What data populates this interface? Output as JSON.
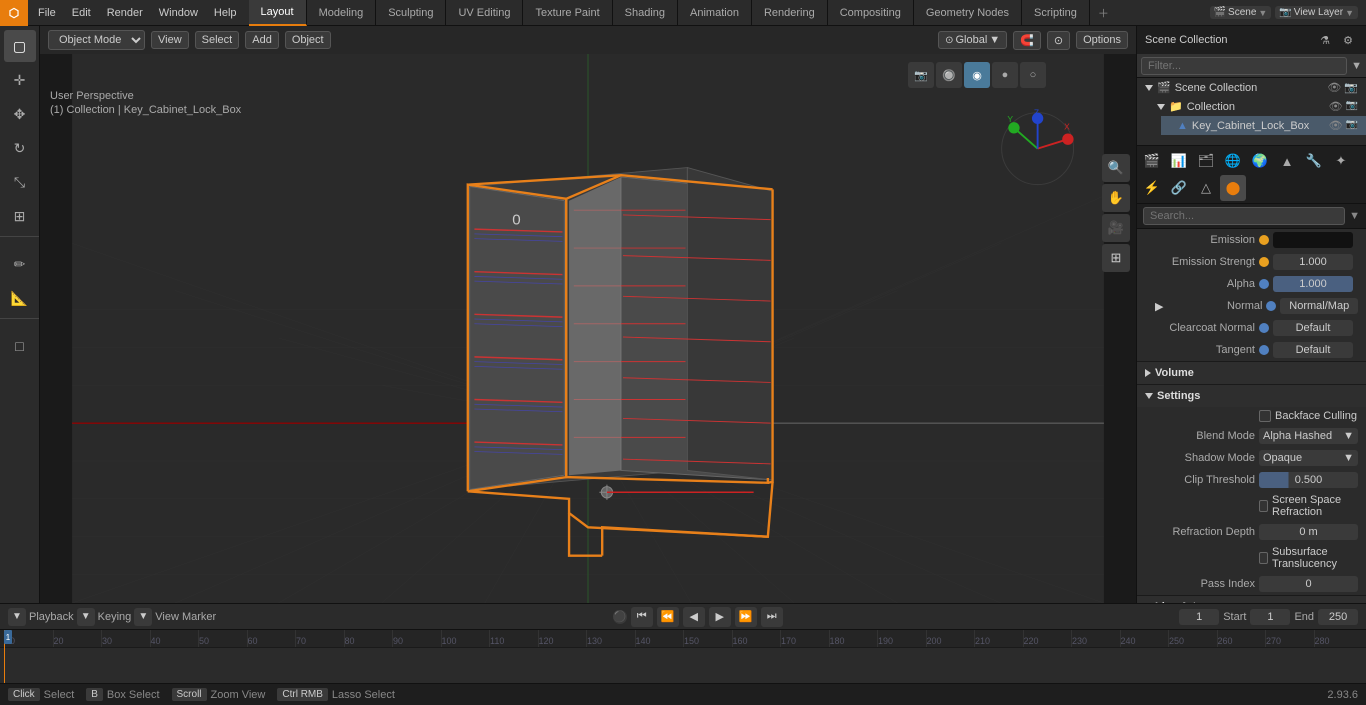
{
  "app": {
    "title": "Blender",
    "version": "2.93.6"
  },
  "menu": {
    "items": [
      "File",
      "Edit",
      "Render",
      "Window",
      "Help"
    ]
  },
  "workspace_tabs": {
    "tabs": [
      "Layout",
      "Modeling",
      "Sculpting",
      "UV Editing",
      "Texture Paint",
      "Shading",
      "Animation",
      "Rendering",
      "Compositing",
      "Geometry Nodes",
      "Scripting"
    ],
    "active": "Layout"
  },
  "viewport": {
    "mode_label": "Object Mode",
    "view_label": "View",
    "select_label": "Select",
    "add_label": "Add",
    "object_label": "Object",
    "transform_label": "Global",
    "camera_label": "User Perspective",
    "collection_label": "(1) Collection | Key_Cabinet_Lock_Box",
    "options_label": "Options"
  },
  "outliner": {
    "title": "Scene Collection",
    "search_placeholder": "Filter...",
    "items": [
      {
        "label": "Scene Collection",
        "level": 0,
        "icon": "scene"
      },
      {
        "label": "Collection",
        "level": 1,
        "icon": "collection"
      },
      {
        "label": "Key_Cabinet_Lock_Box",
        "level": 2,
        "icon": "object",
        "selected": true
      }
    ]
  },
  "properties": {
    "search_placeholder": "Search...",
    "sections": {
      "emission": {
        "label": "Emission",
        "color_value": "#000000",
        "strength_label": "Emission Strengt",
        "strength_value": "1.000",
        "alpha_label": "Alpha",
        "alpha_value": "1.000",
        "normal_label": "Normal",
        "normal_value": "Normal/Map",
        "clearcoat_label": "Clearcoat Normal",
        "clearcoat_value": "Default",
        "tangent_label": "Tangent",
        "tangent_value": "Default"
      },
      "volume": {
        "label": "Volume",
        "collapsed": true
      },
      "settings": {
        "label": "Settings",
        "backface_culling_label": "Backface Culling",
        "backface_culling_checked": false,
        "blend_mode_label": "Blend Mode",
        "blend_mode_value": "Alpha Hashed",
        "shadow_mode_label": "Shadow Mode",
        "shadow_mode_value": "Opaque",
        "clip_threshold_label": "Clip Threshold",
        "clip_threshold_value": "0.500",
        "clip_threshold_percent": 30,
        "screen_space_label": "Screen Space Refraction",
        "screen_space_checked": false,
        "refraction_depth_label": "Refraction Depth",
        "refraction_depth_value": "0 m",
        "subsurface_label": "Subsurface Translucency",
        "subsurface_checked": false,
        "pass_index_label": "Pass Index",
        "pass_index_value": "0"
      }
    }
  },
  "timeline": {
    "current_frame": "1",
    "start_label": "Start",
    "start_value": "1",
    "end_label": "End",
    "end_value": "250",
    "ruler_marks": [
      "10",
      "20",
      "30",
      "40",
      "50",
      "60",
      "70",
      "80",
      "90",
      "100",
      "110",
      "120",
      "130",
      "140",
      "150",
      "160",
      "170",
      "180",
      "190",
      "200",
      "210",
      "220",
      "230",
      "240",
      "250",
      "260",
      "270",
      "280"
    ]
  },
  "status_bar": {
    "select_label": "Select",
    "box_select_label": "Box Select",
    "zoom_label": "Zoom View",
    "lasso_label": "Lasso Select",
    "version": "2.93.6"
  }
}
